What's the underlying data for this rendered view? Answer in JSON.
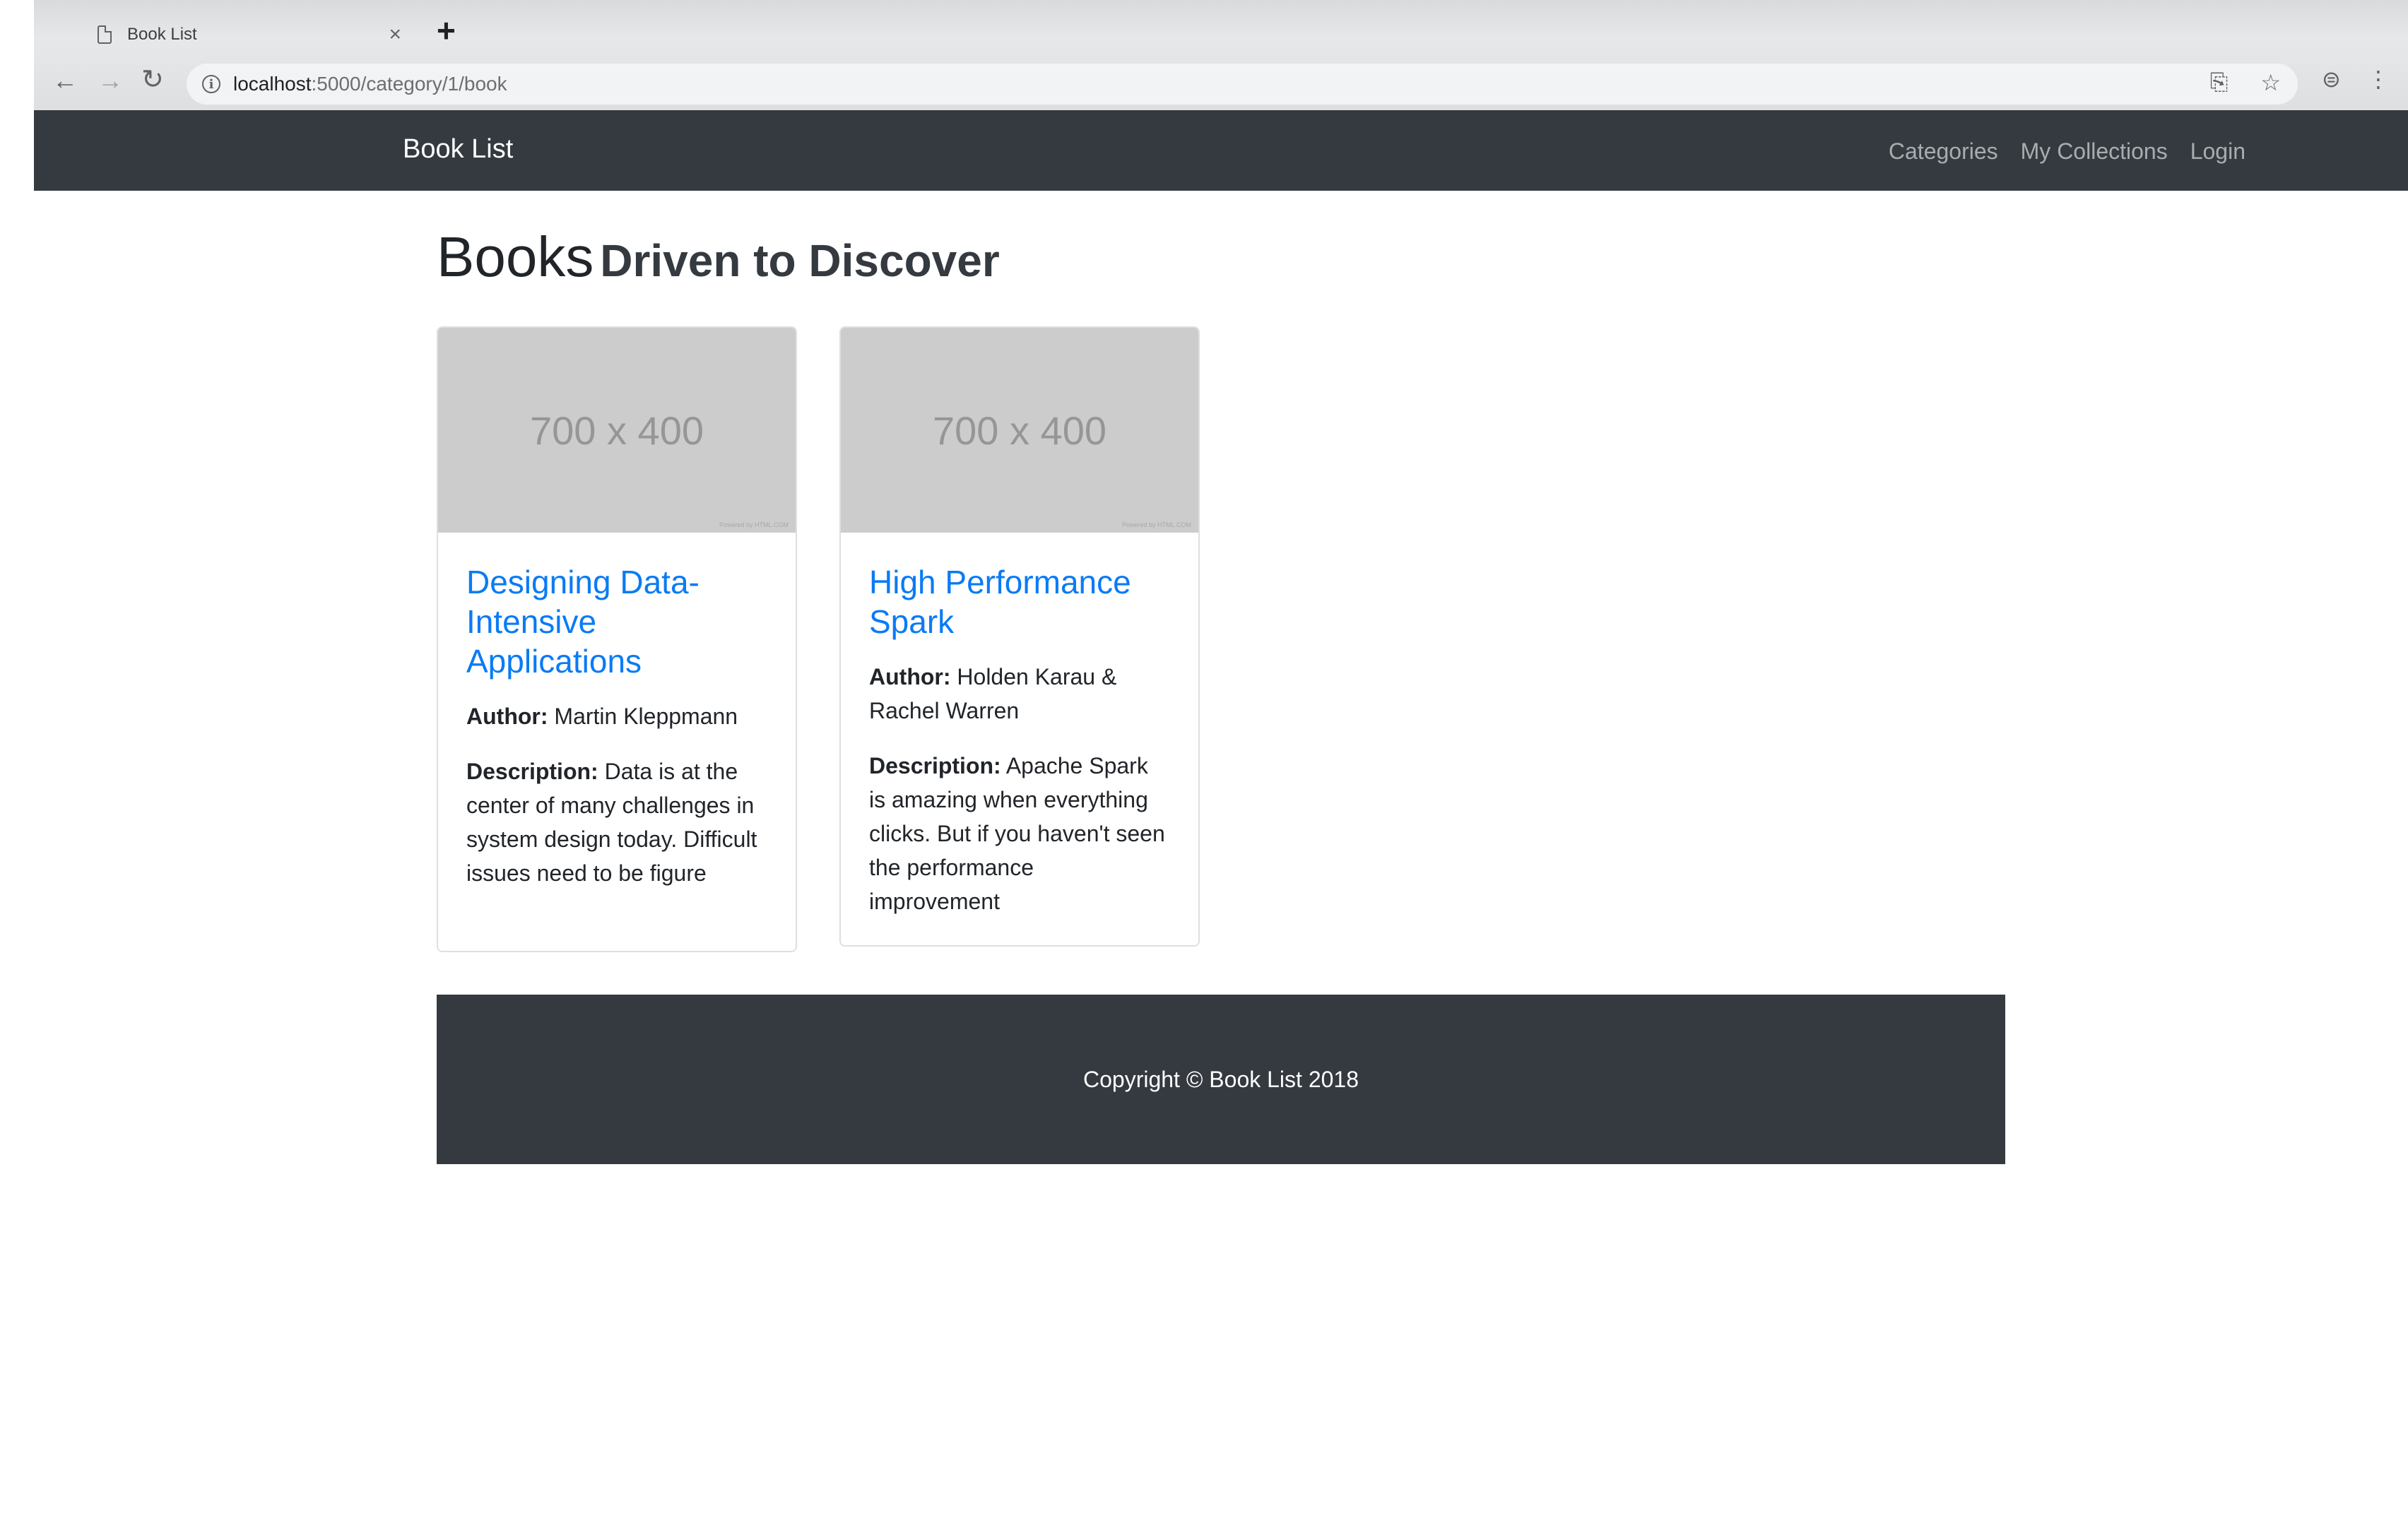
{
  "browser": {
    "tab_title": "Book List",
    "tab_close": "×",
    "new_tab": "+",
    "url_host": "localhost",
    "url_rest": ":5000/category/1/book"
  },
  "navbar": {
    "brand": "Book List",
    "links": [
      "Categories",
      "My Collections",
      "Login"
    ]
  },
  "heading": {
    "main": "Books",
    "sub": "Driven to Discover"
  },
  "books": [
    {
      "image_placeholder": "700 x 400",
      "title": "Designing Data-Intensive Applications",
      "author_label": "Author:",
      "author": "Martin Kleppmann",
      "description_label": "Description:",
      "description": "Data is at the center of many challenges in system design today. Difficult issues need to be figure"
    },
    {
      "image_placeholder": "700 x 400",
      "title": "High Performance Spark",
      "author_label": "Author:",
      "author": "Holden Karau & Rachel Warren",
      "description_label": "Description:",
      "description": "Apache Spark is amazing when everything clicks. But if you haven't seen the performance improvement"
    }
  ],
  "footer": {
    "text": "Copyright © Book List 2018"
  }
}
